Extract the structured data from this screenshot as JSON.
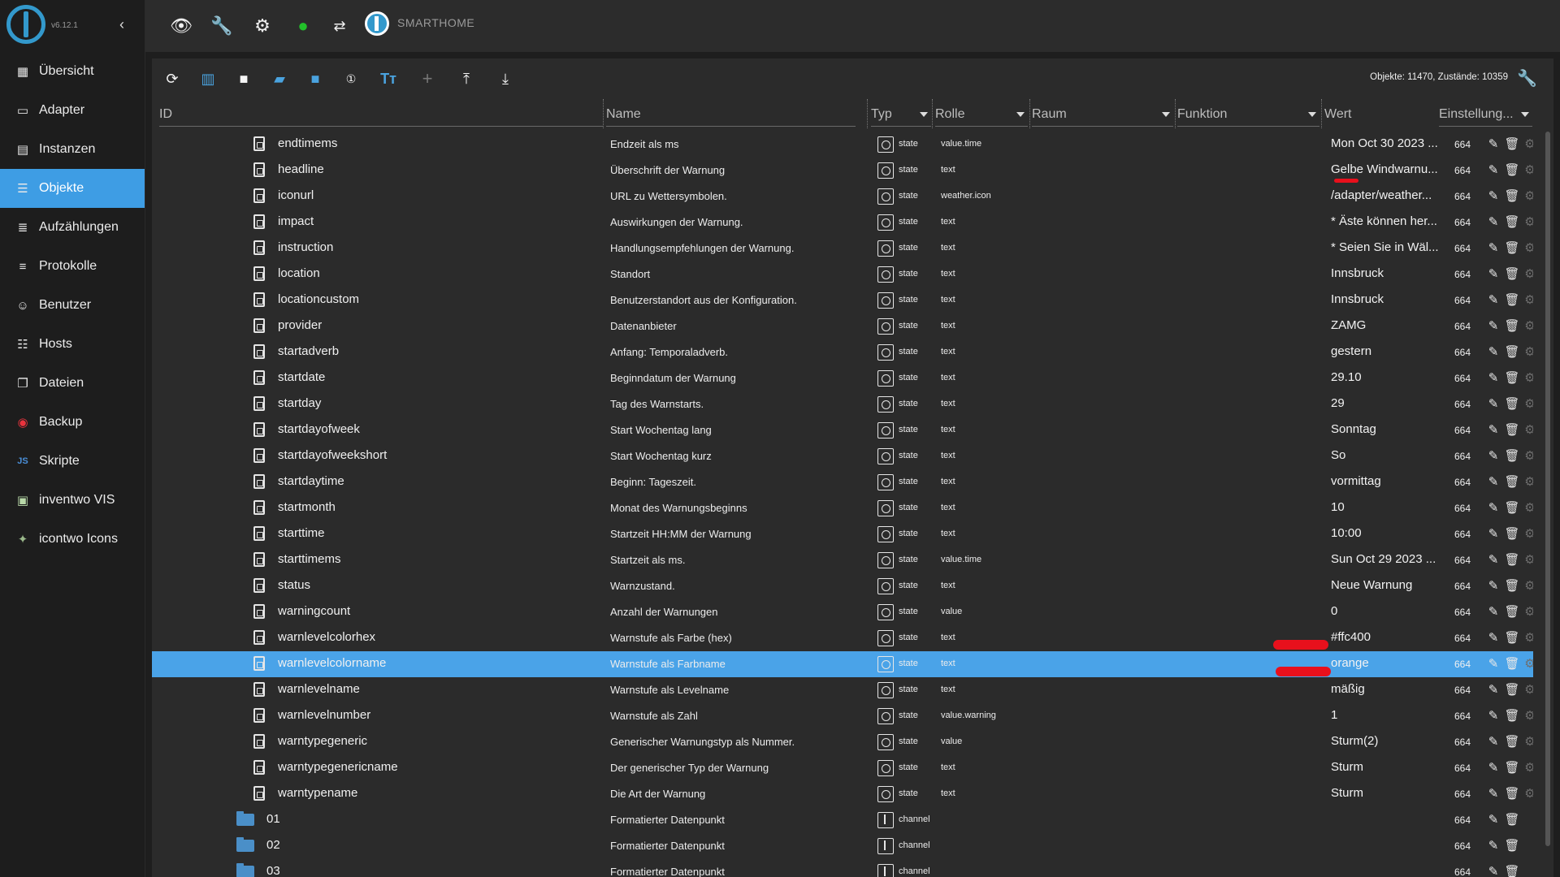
{
  "sidebar": {
    "version": "v6.12.1",
    "items": [
      {
        "label": "Übersicht",
        "icon": "grid-icon",
        "glyph": "▦"
      },
      {
        "label": "Adapter",
        "icon": "adapter-icon",
        "glyph": "▭"
      },
      {
        "label": "Instanzen",
        "icon": "instances-icon",
        "glyph": "▤"
      },
      {
        "label": "Objekte",
        "icon": "objects-icon",
        "glyph": "☰"
      },
      {
        "label": "Aufzählungen",
        "icon": "enums-icon",
        "glyph": "≣"
      },
      {
        "label": "Protokolle",
        "icon": "logs-icon",
        "glyph": "≡"
      },
      {
        "label": "Benutzer",
        "icon": "user-icon",
        "glyph": "☺"
      },
      {
        "label": "Hosts",
        "icon": "hosts-icon",
        "glyph": "☷"
      },
      {
        "label": "Dateien",
        "icon": "files-icon",
        "glyph": "❐"
      },
      {
        "label": "Backup",
        "icon": "backup-icon",
        "glyph": "◉"
      },
      {
        "label": "Skripte",
        "icon": "scripts-icon",
        "glyph": "JS"
      },
      {
        "label": "inventwo VIS",
        "icon": "inventwo-vis-icon",
        "glyph": "▣"
      },
      {
        "label": "icontwo Icons",
        "icon": "icontwo-icons-icon",
        "glyph": "✦"
      }
    ],
    "active_index": 3
  },
  "topbar": {
    "brand_title": "SMARTHOME"
  },
  "toolbar": {
    "stats": "Objekte: 11470, Zustände: 10359"
  },
  "columns": {
    "id": "ID",
    "name": "Name",
    "type": "Typ",
    "role": "Rolle",
    "room": "Raum",
    "function": "Funktion",
    "value": "Wert",
    "settings": "Einstellung..."
  },
  "rows": [
    {
      "kind": "state",
      "id": "endtimems",
      "name": "Endzeit als ms",
      "type": "state",
      "role": "value.time",
      "value": "Mon Oct 30 2023 ...",
      "acl": "664"
    },
    {
      "kind": "state",
      "id": "headline",
      "name": "Überschrift der Warnung",
      "type": "state",
      "role": "text",
      "value": "Gelbe Windwarnu...",
      "acl": "664"
    },
    {
      "kind": "state",
      "id": "iconurl",
      "name": "URL zu Wettersymbolen.",
      "type": "state",
      "role": "weather.icon",
      "value": "/adapter/weather...",
      "acl": "664"
    },
    {
      "kind": "state",
      "id": "impact",
      "name": "Auswirkungen der Warnung.",
      "type": "state",
      "role": "text",
      "value": "* Äste können her...",
      "acl": "664"
    },
    {
      "kind": "state",
      "id": "instruction",
      "name": "Handlungsempfehlungen der Warnung.",
      "type": "state",
      "role": "text",
      "value": "* Seien Sie in Wäl...",
      "acl": "664"
    },
    {
      "kind": "state",
      "id": "location",
      "name": "Standort",
      "type": "state",
      "role": "text",
      "value": "Innsbruck",
      "acl": "664"
    },
    {
      "kind": "state",
      "id": "locationcustom",
      "name": "Benutzerstandort aus der Konfiguration.",
      "type": "state",
      "role": "text",
      "value": "Innsbruck",
      "acl": "664"
    },
    {
      "kind": "state",
      "id": "provider",
      "name": "Datenanbieter",
      "type": "state",
      "role": "text",
      "value": "ZAMG",
      "acl": "664"
    },
    {
      "kind": "state",
      "id": "startadverb",
      "name": "Anfang: Temporaladverb.",
      "type": "state",
      "role": "text",
      "value": "gestern",
      "acl": "664"
    },
    {
      "kind": "state",
      "id": "startdate",
      "name": "Beginndatum der Warnung",
      "type": "state",
      "role": "text",
      "value": "29.10",
      "acl": "664"
    },
    {
      "kind": "state",
      "id": "startday",
      "name": "Tag des Warnstarts.",
      "type": "state",
      "role": "text",
      "value": "29",
      "acl": "664"
    },
    {
      "kind": "state",
      "id": "startdayofweek",
      "name": "Start Wochentag lang",
      "type": "state",
      "role": "text",
      "value": "Sonntag",
      "acl": "664"
    },
    {
      "kind": "state",
      "id": "startdayofweekshort",
      "name": "Start Wochentag kurz",
      "type": "state",
      "role": "text",
      "value": "So",
      "acl": "664"
    },
    {
      "kind": "state",
      "id": "startdaytime",
      "name": "Beginn: Tageszeit.",
      "type": "state",
      "role": "text",
      "value": "vormittag",
      "acl": "664"
    },
    {
      "kind": "state",
      "id": "startmonth",
      "name": "Monat des Warnungsbeginns",
      "type": "state",
      "role": "text",
      "value": "10",
      "acl": "664"
    },
    {
      "kind": "state",
      "id": "starttime",
      "name": "Startzeit HH:MM der Warnung",
      "type": "state",
      "role": "text",
      "value": "10:00",
      "acl": "664"
    },
    {
      "kind": "state",
      "id": "starttimems",
      "name": "Startzeit als ms.",
      "type": "state",
      "role": "value.time",
      "value": "Sun Oct 29 2023 ...",
      "acl": "664"
    },
    {
      "kind": "state",
      "id": "status",
      "name": "Warnzustand.",
      "type": "state",
      "role": "text",
      "value": "Neue Warnung",
      "acl": "664"
    },
    {
      "kind": "state",
      "id": "warningcount",
      "name": "Anzahl der Warnungen",
      "type": "state",
      "role": "value",
      "value": "0",
      "acl": "664"
    },
    {
      "kind": "state",
      "id": "warnlevelcolorhex",
      "name": "Warnstufe als Farbe (hex)",
      "type": "state",
      "role": "text",
      "value": "#ffc400",
      "acl": "664"
    },
    {
      "kind": "state",
      "id": "warnlevelcolorname",
      "name": "Warnstufe als Farbname",
      "type": "state",
      "role": "text",
      "value": "orange",
      "acl": "664",
      "selected": true
    },
    {
      "kind": "state",
      "id": "warnlevelname",
      "name": "Warnstufe als Levelname",
      "type": "state",
      "role": "text",
      "value": "mäßig",
      "acl": "664"
    },
    {
      "kind": "state",
      "id": "warnlevelnumber",
      "name": "Warnstufe als Zahl",
      "type": "state",
      "role": "value.warning",
      "value": "1",
      "acl": "664"
    },
    {
      "kind": "state",
      "id": "warntypegeneric",
      "name": "Generischer Warnungstyp als Nummer.",
      "type": "state",
      "role": "value",
      "value": "Sturm(2)",
      "acl": "664"
    },
    {
      "kind": "state",
      "id": "warntypegenericname",
      "name": "Der generischer Typ der Warnung",
      "type": "state",
      "role": "text",
      "value": "Sturm",
      "acl": "664"
    },
    {
      "kind": "state",
      "id": "warntypename",
      "name": "Die Art der Warnung",
      "type": "state",
      "role": "text",
      "value": "Sturm",
      "acl": "664"
    },
    {
      "kind": "channel",
      "id": "01",
      "name": "Formatierter Datenpunkt",
      "type": "channel",
      "role": "",
      "value": "",
      "acl": "664"
    },
    {
      "kind": "channel",
      "id": "02",
      "name": "Formatierter Datenpunkt",
      "type": "channel",
      "role": "",
      "value": "",
      "acl": "664"
    },
    {
      "kind": "channel",
      "id": "03",
      "name": "Formatierter Datenpunkt",
      "type": "channel",
      "role": "",
      "value": "",
      "acl": "664"
    }
  ],
  "colors": {
    "accent": "#3e9de4",
    "selected_row": "#4aa3e8",
    "folder": "#4a8fc8",
    "annotation_red": "#e8101c",
    "logo": "#3399cc"
  }
}
